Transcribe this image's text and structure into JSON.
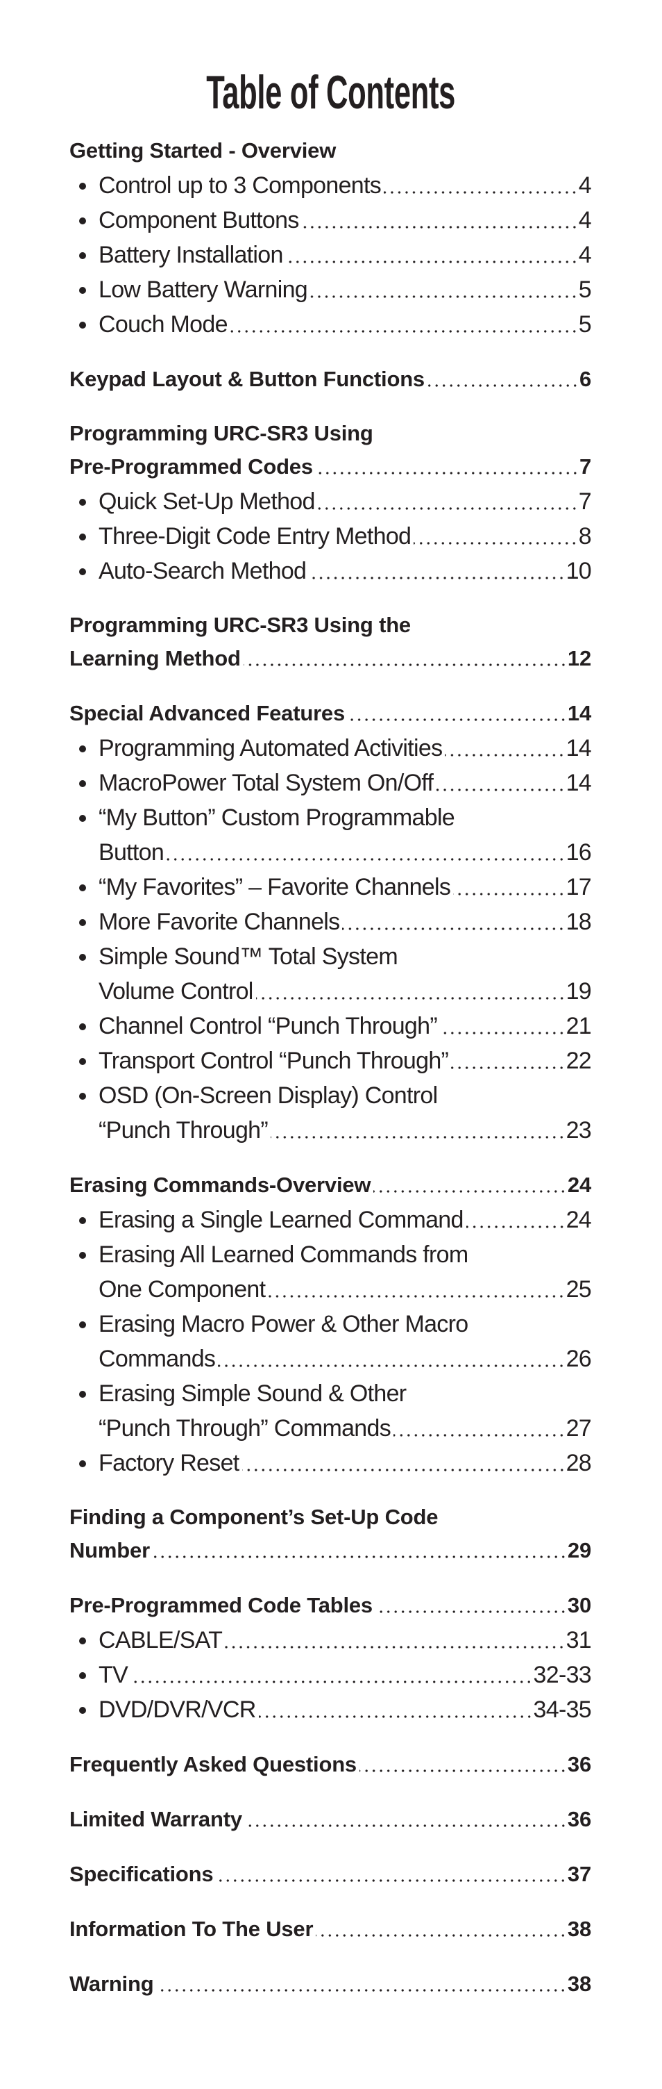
{
  "title": "Table of Contents",
  "sections": [
    {
      "heading": [
        "Getting Started - Overview"
      ],
      "page": "",
      "items": [
        {
          "lines": [
            "Control up to 3 Components"
          ],
          "page": "4"
        },
        {
          "lines": [
            "Component Buttons"
          ],
          "page": "4"
        },
        {
          "lines": [
            "Battery Installation"
          ],
          "page": "4"
        },
        {
          "lines": [
            "Low Battery Warning"
          ],
          "page": "5"
        },
        {
          "lines": [
            "Couch Mode"
          ],
          "page": "5"
        }
      ]
    },
    {
      "heading": [
        "Keypad Layout & Button Functions"
      ],
      "page": "6",
      "items": []
    },
    {
      "heading": [
        "Programming URC-SR3 Using",
        "Pre-Programmed Codes"
      ],
      "page": "7",
      "items": [
        {
          "lines": [
            "Quick Set-Up Method"
          ],
          "page": "7"
        },
        {
          "lines": [
            "Three-Digit Code Entry Method"
          ],
          "page": "8"
        },
        {
          "lines": [
            "Auto-Search Method"
          ],
          "page": "10"
        }
      ]
    },
    {
      "heading": [
        "Programming URC-SR3 Using the",
        "Learning Method"
      ],
      "page": "12",
      "items": []
    },
    {
      "heading": [
        "Special Advanced Features"
      ],
      "page": "14",
      "items": [
        {
          "lines": [
            "Programming Automated Activities"
          ],
          "page": "14"
        },
        {
          "lines": [
            "MacroPower Total System On/Off"
          ],
          "page": "14"
        },
        {
          "lines": [
            "“My Button” Custom Programmable",
            "Button"
          ],
          "page": "16"
        },
        {
          "lines": [
            "“My Favorites” – Favorite Channels"
          ],
          "page": "17"
        },
        {
          "lines": [
            "More Favorite Channels"
          ],
          "page": "18"
        },
        {
          "lines": [
            "Simple Sound™ Total System",
            "Volume Control"
          ],
          "page": "19"
        },
        {
          "lines": [
            "Channel Control “Punch Through”"
          ],
          "page": "21"
        },
        {
          "lines": [
            "Transport Control “Punch Through”"
          ],
          "page": "22"
        },
        {
          "lines": [
            "OSD (On-Screen Display) Control",
            "“Punch Through”"
          ],
          "page": "23"
        }
      ]
    },
    {
      "heading": [
        "Erasing Commands-Overview"
      ],
      "page": "24",
      "items": [
        {
          "lines": [
            "Erasing a Single Learned Command"
          ],
          "page": "24"
        },
        {
          "lines": [
            "Erasing All Learned Commands from",
            "One Component"
          ],
          "page": "25"
        },
        {
          "lines": [
            "Erasing Macro Power & Other Macro",
            "Commands"
          ],
          "page": "26"
        },
        {
          "lines": [
            "Erasing Simple Sound & Other",
            "“Punch Through” Commands"
          ],
          "page": "27"
        },
        {
          "lines": [
            "Factory Reset"
          ],
          "page": "28"
        }
      ]
    },
    {
      "heading": [
        "Finding a Component’s Set-Up Code",
        "Number"
      ],
      "page": "29",
      "items": []
    },
    {
      "heading": [
        "Pre-Programmed Code Tables"
      ],
      "page": "30",
      "items": [
        {
          "lines": [
            "CABLE/SAT"
          ],
          "page": "31"
        },
        {
          "lines": [
            "TV"
          ],
          "page": "32-33"
        },
        {
          "lines": [
            "DVD/DVR/VCR"
          ],
          "page": "34-35"
        }
      ]
    },
    {
      "heading": [
        "Frequently Asked Questions"
      ],
      "page": "36",
      "items": []
    },
    {
      "heading": [
        "Limited Warranty"
      ],
      "page": "36",
      "items": []
    },
    {
      "heading": [
        "Specifications"
      ],
      "page": "37",
      "items": []
    },
    {
      "heading": [
        "Information To The User"
      ],
      "page": "38",
      "items": []
    },
    {
      "heading": [
        "Warning"
      ],
      "page": "38",
      "items": []
    }
  ]
}
